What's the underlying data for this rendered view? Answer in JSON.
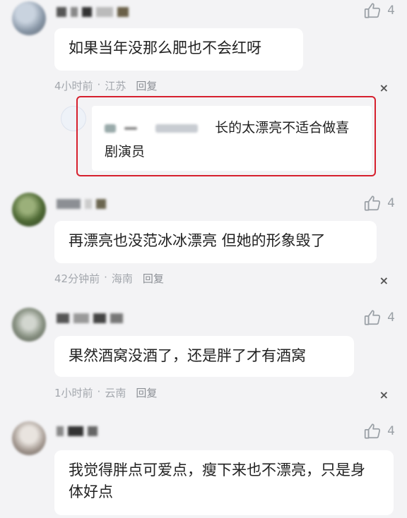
{
  "comments": [
    {
      "text": "如果当年没那么肥也不会红呀",
      "time": "4小时前",
      "location": "江苏",
      "reply_label": "回复",
      "likes": "4",
      "close": "×"
    },
    {
      "text": "再漂亮也没范冰冰漂亮 但她的形象毁了",
      "time": "42分钟前",
      "location": "海南",
      "reply_label": "回复",
      "likes": "4",
      "close": "×"
    },
    {
      "text": "果然酒窝没酒了，还是胖了才有酒窝",
      "time": "1小时前",
      "location": "云南",
      "reply_label": "回复",
      "likes": "4",
      "close": "×"
    },
    {
      "text": "我觉得胖点可爱点，瘦下来也不漂亮，只是身体好点",
      "likes": "4"
    }
  ],
  "quoted_reply": {
    "text": "长的太漂亮不适合做喜剧演员"
  },
  "meta_separator": "·",
  "colors": {
    "highlight_border": "#d6202e",
    "bubble_bg": "#ffffff",
    "page_bg": "#f3f3f5"
  }
}
